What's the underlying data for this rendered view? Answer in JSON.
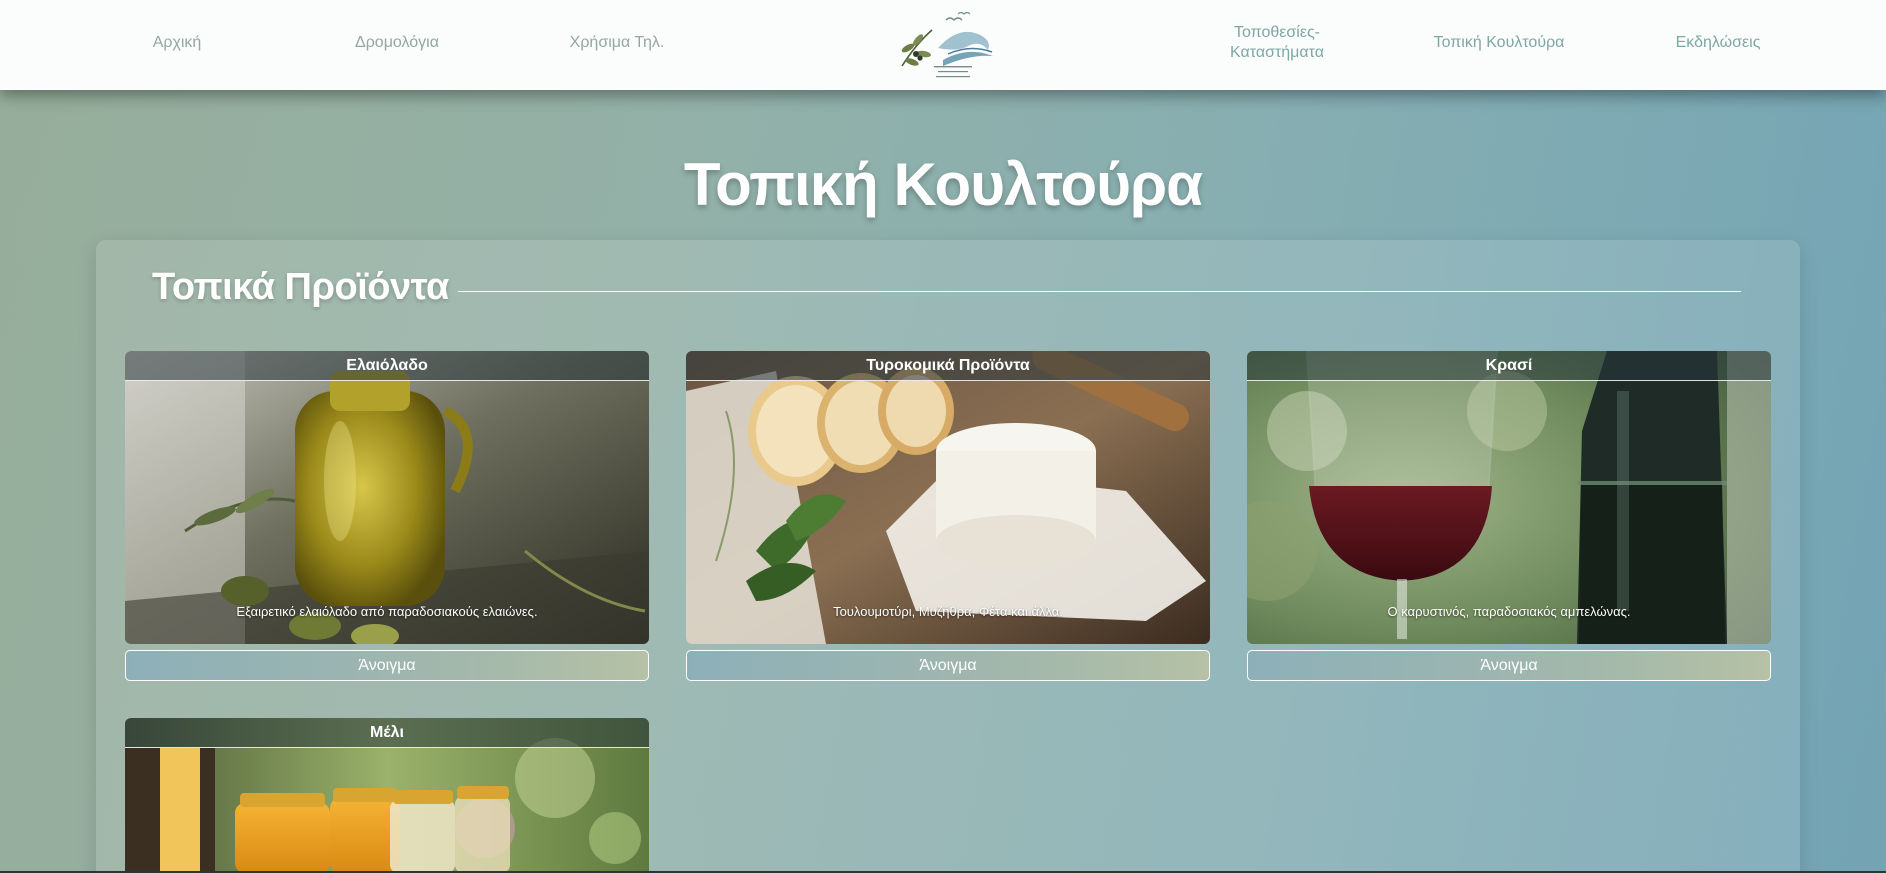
{
  "nav": {
    "items": [
      {
        "label": "Αρχική"
      },
      {
        "label": "Δρομολόγια"
      },
      {
        "label": "Χρήσιμα Τηλ."
      },
      {
        "label": "Τοποθεσίες-\nΚαταστήματα"
      },
      {
        "label": "Τοπική Κουλτούρα"
      },
      {
        "label": "Εκδηλώσεις"
      }
    ],
    "logo_icon": "olive-wave-logo"
  },
  "page": {
    "title": "Τοπική Κουλτούρα"
  },
  "section": {
    "title": "Τοπικά Προϊόντα",
    "cards": [
      {
        "title": "Ελαιόλαδο",
        "description": "Εξαιρετικό ελαιόλαδο από παραδοσιακούς ελαιώνες.",
        "button": "Άνοιγμα",
        "image_icon": "olive-oil-image"
      },
      {
        "title": "Τυροκομικά Προϊόντα",
        "description": "Τουλουμοτύρι, Μυζήθρα, Φέτα και άλλα.",
        "button": "Άνοιγμα",
        "image_icon": "cheese-image"
      },
      {
        "title": "Κρασί",
        "description": "Ο καρυστινός, παραδοσιακός αμπελώνας.",
        "button": "Άνοιγμα",
        "image_icon": "wine-image"
      },
      {
        "title": "Μέλι",
        "image_icon": "honey-image"
      }
    ]
  },
  "colors": {
    "nav_text": "#7ea7a4",
    "background_start": "#97ad9a",
    "background_end": "#73a4b4"
  }
}
